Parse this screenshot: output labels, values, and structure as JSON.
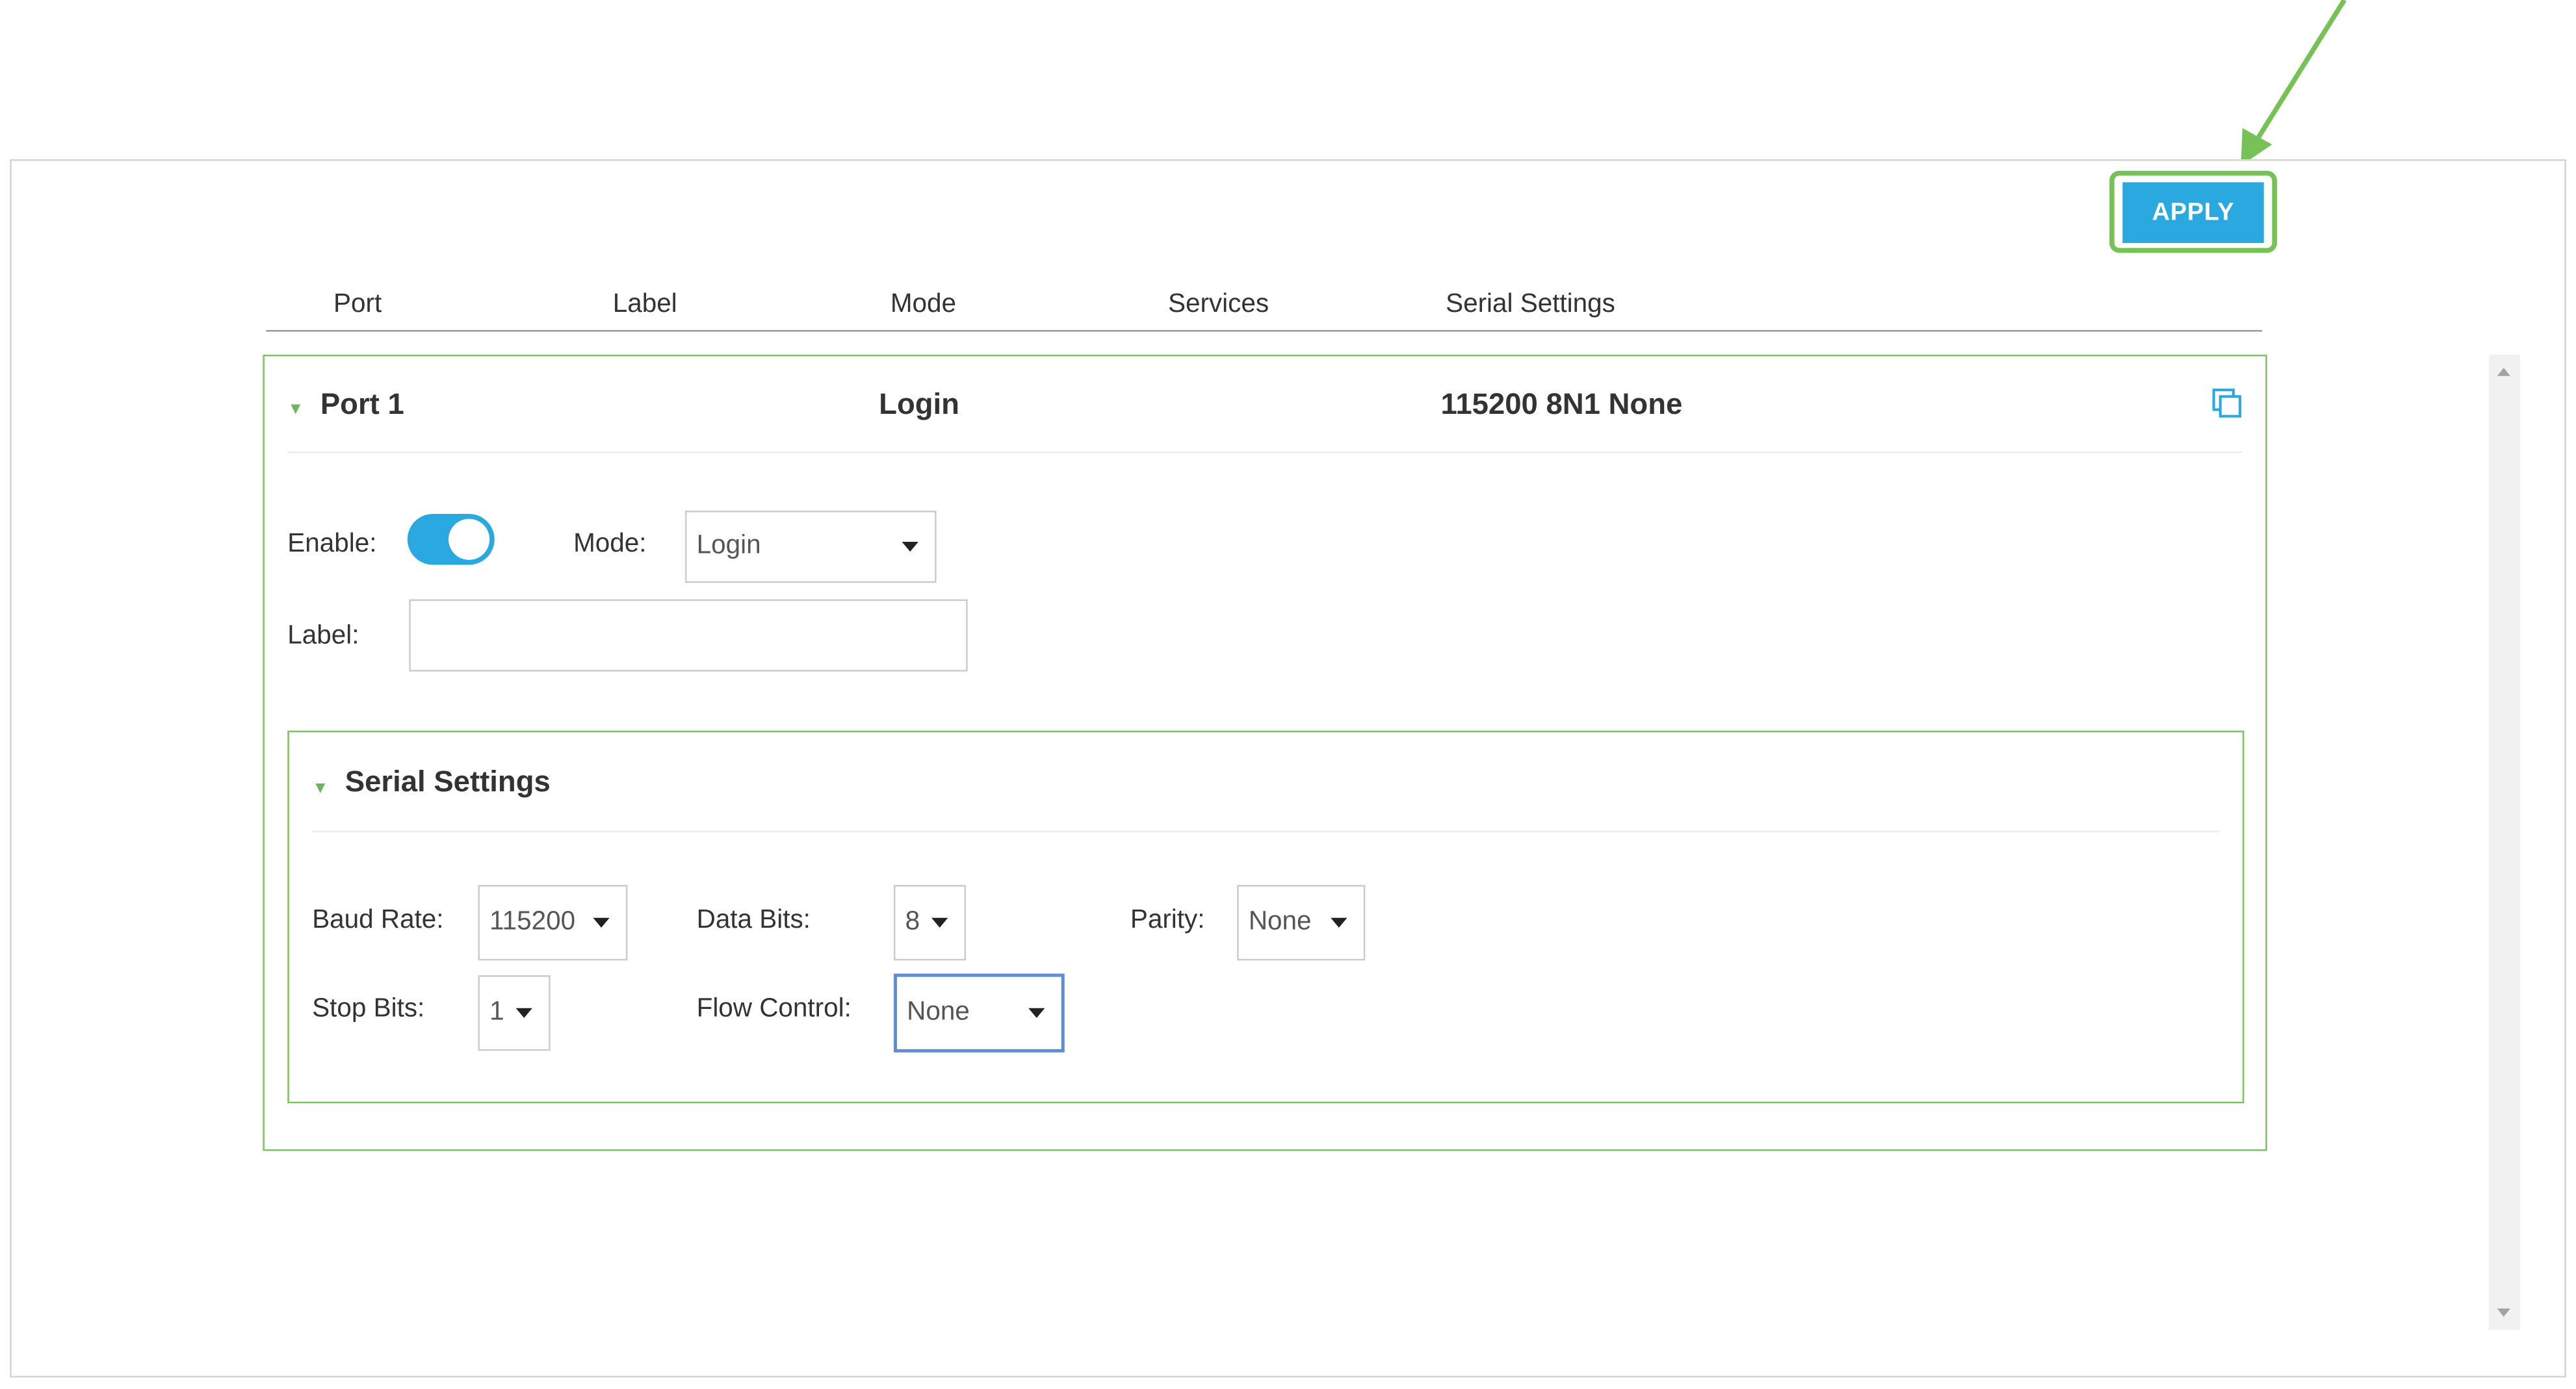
{
  "toolbar": {
    "apply_label": "APPLY"
  },
  "table": {
    "columns": [
      "Port",
      "Label",
      "Mode",
      "Services",
      "Serial Settings"
    ]
  },
  "port": {
    "summary": {
      "name": "Port 1",
      "mode": "Login",
      "serial": "115200 8N1 None"
    },
    "enable_label": "Enable:",
    "enable_on": true,
    "mode_label": "Mode:",
    "mode_value": "Login",
    "label_label": "Label:",
    "label_value": ""
  },
  "serial": {
    "title": "Serial Settings",
    "baud_label": "Baud Rate:",
    "baud_value": "115200",
    "data_bits_label": "Data Bits:",
    "data_bits_value": "8",
    "parity_label": "Parity:",
    "parity_value": "None",
    "stop_bits_label": "Stop Bits:",
    "stop_bits_value": "1",
    "flow_label": "Flow Control:",
    "flow_value": "None"
  },
  "colors": {
    "accent_blue": "#29a9df",
    "accent_green": "#6db55a",
    "highlight_green": "#77c257"
  },
  "icons": [
    "copy-icon",
    "caret-down-icon",
    "arrow-annotation"
  ]
}
